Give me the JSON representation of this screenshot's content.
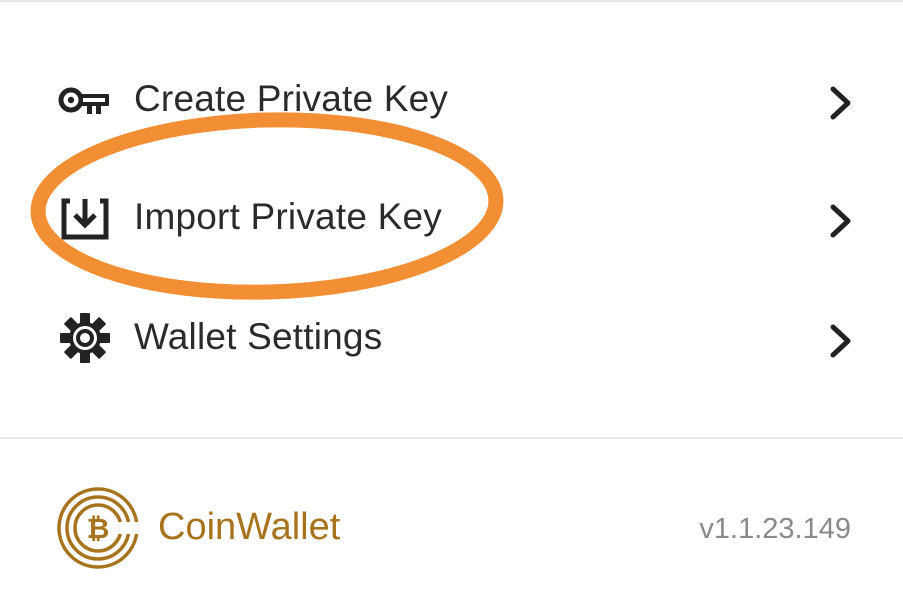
{
  "menu": {
    "items": [
      {
        "label": "Create Private Key",
        "icon": "key-icon"
      },
      {
        "label": "Import Private Key",
        "icon": "import-icon"
      },
      {
        "label": "Wallet Settings",
        "icon": "gear-icon"
      }
    ],
    "chevron_icon": "chevron-right-icon"
  },
  "highlight": {
    "color": "#f28f34",
    "target_item": "Import Private Key"
  },
  "footer": {
    "brand_name": "CoinWallet",
    "version": "v1.1.23.149",
    "logo_icon": "coinwallet-bitcoin-logo",
    "brand_color": "#a8731d"
  },
  "colors": {
    "text": "#2b2b2b",
    "divider": "#e8e8e8",
    "version_text": "#8a8a8a",
    "background": "#ffffff"
  }
}
